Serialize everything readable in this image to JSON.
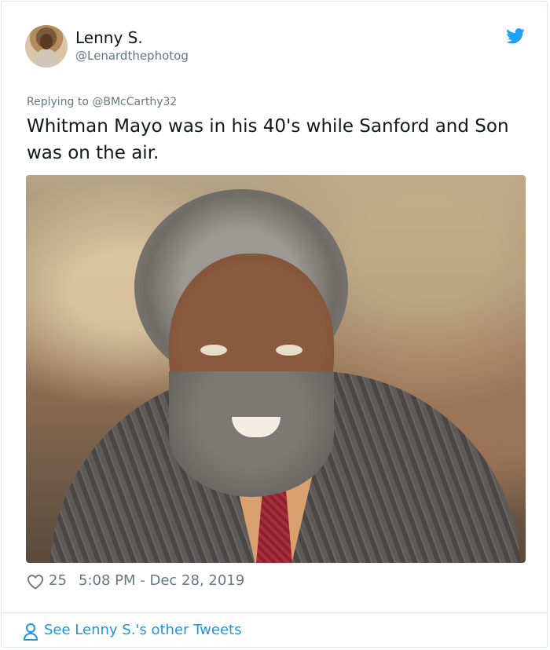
{
  "tweet": {
    "author_name": "Lenny S.",
    "author_handle": "@Lenardthephotog",
    "replying_to": "Replying to @BMcCarthy32",
    "text": "Whitman Mayo was in his 40's while Sanford and Son was on the air.",
    "like_count": "25",
    "timestamp": "5:08 PM - Dec 28, 2019",
    "see_more": "See Lenny S.'s other Tweets",
    "icons": {
      "brand": "twitter-bird-icon",
      "like": "heart-icon",
      "profile": "user-icon"
    },
    "colors": {
      "brand": "#1da1f2",
      "link": "#1b95e0",
      "secondary_text": "#657786",
      "primary_text": "#14171a",
      "border": "#e1e8ed"
    }
  }
}
